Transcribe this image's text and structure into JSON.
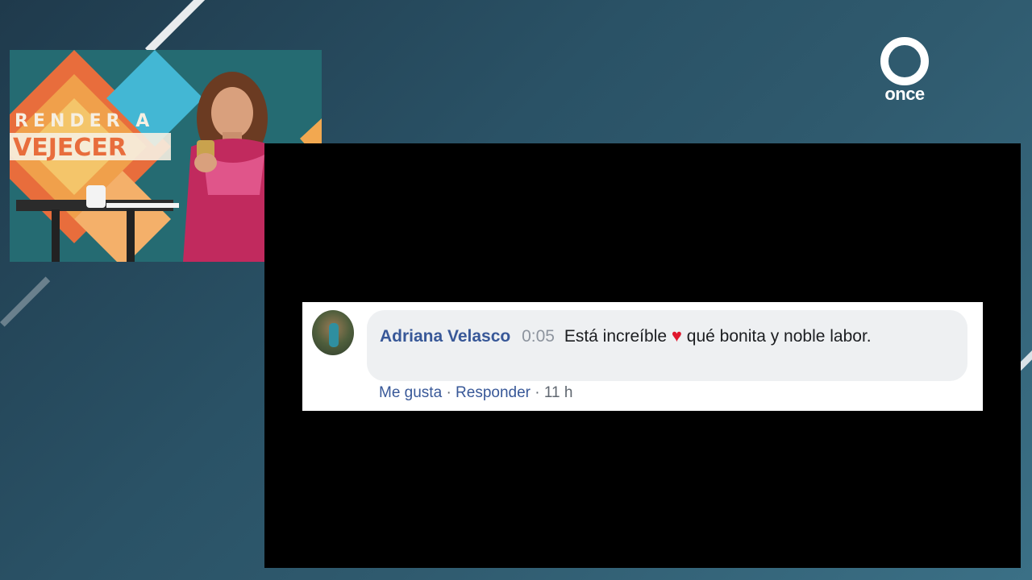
{
  "brand": {
    "logo_text": "once"
  },
  "pip": {
    "set_title_line1": "RENDER A",
    "set_title_line2": "VEJECER"
  },
  "comment": {
    "author": "Adriana Velasco",
    "timestamp": "0:05",
    "text_before_emoji": "Está increíble",
    "emoji": "♥",
    "text_after_emoji": "qué bonita y noble labor.",
    "like_label": "Me gusta",
    "separator": "·",
    "reply_label": "Responder",
    "age": "11 h"
  },
  "colors": {
    "name_link": "#385898",
    "heart": "#e0182e",
    "bubble": "#eef0f2"
  }
}
